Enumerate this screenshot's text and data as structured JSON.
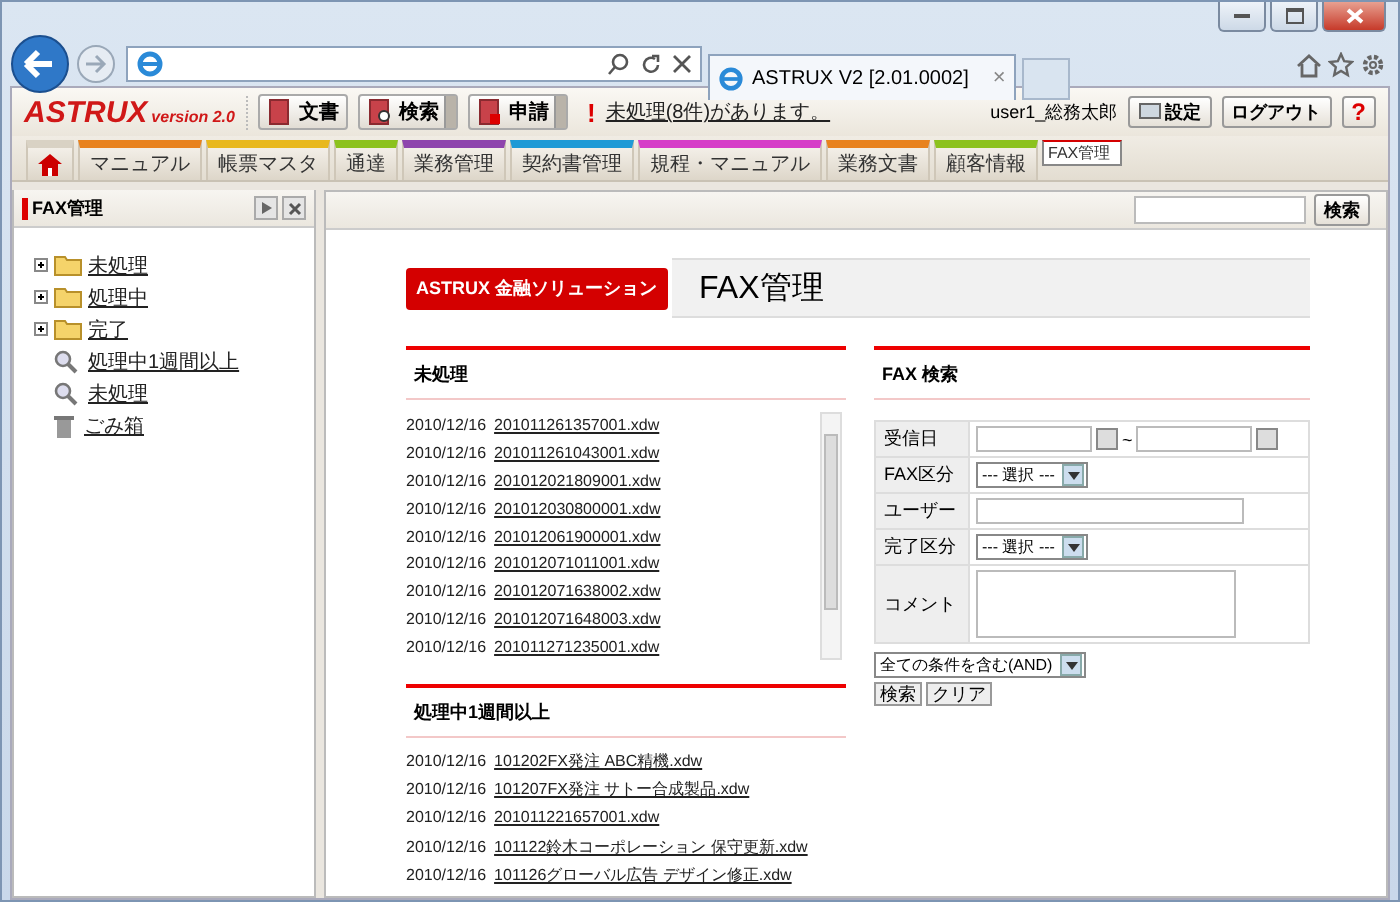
{
  "browser": {
    "tab_title": "ASTRUX V2 [2.01.0002]",
    "tab_close": "×"
  },
  "app_header": {
    "logo": "ASTRUX",
    "version": "version 2.0",
    "buttons": [
      {
        "label": "文書",
        "dropdown": false
      },
      {
        "label": "検索",
        "dropdown": true
      },
      {
        "label": "申請",
        "dropdown": true
      }
    ],
    "notice_mark": "!",
    "notice": "未処理(8件)があります。",
    "user": "user1_総務太郎",
    "settings": "設定",
    "logout": "ログアウト",
    "help": "?"
  },
  "tabs": [
    {
      "kind": "home",
      "color": "#d9d2c4",
      "selected": false
    },
    {
      "kind": "text",
      "label": "マニュアル",
      "color": "#e8821e",
      "selected": false
    },
    {
      "kind": "text",
      "label": "帳票マスタ",
      "color": "#e8b81e",
      "selected": false
    },
    {
      "kind": "text",
      "label": "通達",
      "color": "#8cc21e",
      "selected": false
    },
    {
      "kind": "text",
      "label": "業務管理",
      "color": "#8e44ad",
      "selected": false
    },
    {
      "kind": "text",
      "label": "契約書管理",
      "color": "#1e9ad6",
      "selected": false
    },
    {
      "kind": "text",
      "label": "規程・マニュアル",
      "color": "#d63cc8",
      "selected": false
    },
    {
      "kind": "text",
      "label": "業務文書",
      "color": "#e8821e",
      "selected": false
    },
    {
      "kind": "text",
      "label": "顧客情報",
      "color": "#8cc21e",
      "selected": false
    },
    {
      "kind": "text",
      "label": "FAX管理",
      "color": "#d40000",
      "selected": true
    }
  ],
  "sidebar": {
    "title": "FAX管理",
    "items": [
      {
        "kind": "folder",
        "label": "未処理",
        "expanded": false
      },
      {
        "kind": "folder",
        "label": "処理中",
        "expanded": false
      },
      {
        "kind": "folder",
        "label": "完了",
        "expanded": false
      },
      {
        "kind": "search",
        "label": "処理中1週間以上"
      },
      {
        "kind": "search",
        "label": "未処理"
      },
      {
        "kind": "trash",
        "label": "ごみ箱"
      }
    ]
  },
  "search_bar": {
    "button": "検索"
  },
  "banner": {
    "badge": "ASTRUX 金融ソリューション",
    "title": "FAX管理"
  },
  "unprocessed": {
    "title": "未処理",
    "rows": [
      {
        "date": "2010/12/16",
        "file": "201011261357001.xdw"
      },
      {
        "date": "2010/12/16",
        "file": "201011261043001.xdw"
      },
      {
        "date": "2010/12/16",
        "file": "201012021809001.xdw"
      },
      {
        "date": "2010/12/16",
        "file": "201012030800001.xdw"
      },
      {
        "date": "2010/12/16",
        "file": "201012061900001.xdw"
      },
      {
        "date": "2010/12/16",
        "file": "201012071011001.xdw"
      },
      {
        "date": "2010/12/16",
        "file": "201012071638002.xdw"
      },
      {
        "date": "2010/12/16",
        "file": "201012071648003.xdw"
      },
      {
        "date": "2010/12/16",
        "file": "201011271235001.xdw"
      }
    ]
  },
  "overdue": {
    "title": "処理中1週間以上",
    "rows": [
      {
        "date": "2010/12/16",
        "file": "101202FX発注 ABC精機.xdw"
      },
      {
        "date": "2010/12/16",
        "file": "101207FX発注 サトー合成製品.xdw"
      },
      {
        "date": "2010/12/16",
        "file": "201011221657001.xdw"
      },
      {
        "date": "2010/12/16",
        "file": "101122鈴木コーポレーション 保守更新.xdw"
      },
      {
        "date": "2010/12/16",
        "file": "101126グローバル広告 デザイン修正.xdw"
      }
    ]
  },
  "fax_search": {
    "title": "FAX 検索",
    "fields": [
      {
        "label": "受信日",
        "kind": "date_range",
        "separator": "~"
      },
      {
        "label": "FAX区分",
        "kind": "select",
        "value": "--- 選択 ---"
      },
      {
        "label": "ユーザー",
        "kind": "text"
      },
      {
        "label": "完了区分",
        "kind": "select",
        "value": "--- 選択 ---"
      },
      {
        "label": "コメント",
        "kind": "textarea"
      }
    ],
    "condition": "全ての条件を含む(AND)",
    "buttons": [
      "検索",
      "クリア"
    ]
  }
}
